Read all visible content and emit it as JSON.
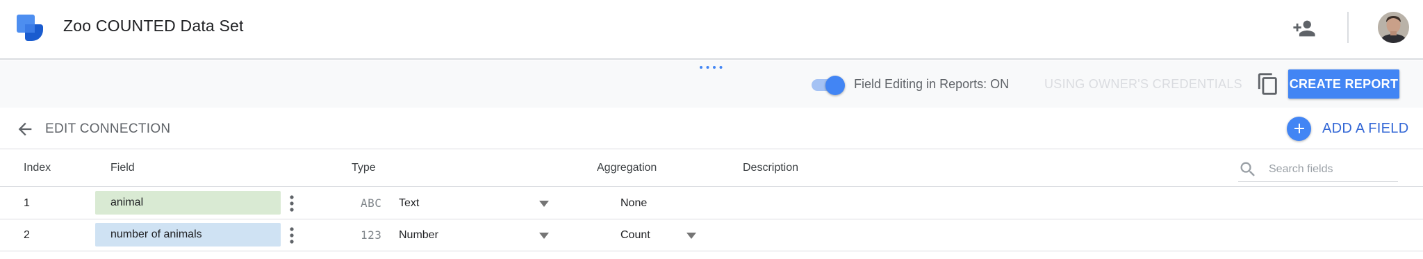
{
  "app": {
    "title": "Zoo COUNTED Data Set",
    "logo_icon": "data-studio-logo-icon",
    "add_person_icon": "person-add-icon",
    "avatar_icon": "user-avatar"
  },
  "toolbar": {
    "toggle_label": "Field Editing in Reports: ON",
    "toggle_on": true,
    "credentials_label": "USING OWNER'S CREDENTIALS",
    "copy_icon": "copy-icon",
    "create_report_label": "CREATE REPORT"
  },
  "edit_bar": {
    "label": "EDIT CONNECTION",
    "add_field_label": "ADD A FIELD",
    "add_field_icon": "plus-icon"
  },
  "table": {
    "headers": {
      "index": "Index",
      "field": "Field",
      "type": "Type",
      "aggregation": "Aggregation",
      "description": "Description"
    },
    "search_placeholder": "Search fields",
    "rows": [
      {
        "index": "1",
        "field": "animal",
        "type_icon": "ABC",
        "type": "Text",
        "aggregation": "None",
        "aggregation_dropdown": false
      },
      {
        "index": "2",
        "field": "number of animals",
        "type_icon": "123",
        "type": "Number",
        "aggregation": "Count",
        "aggregation_dropdown": true
      }
    ]
  },
  "colors": {
    "accent": "#4285f4",
    "accent_text": "#3367d6",
    "dimension_chip": "#d9ead3",
    "metric_chip": "#cfe2f3",
    "toolbar_bg": "#f8f9fa"
  }
}
